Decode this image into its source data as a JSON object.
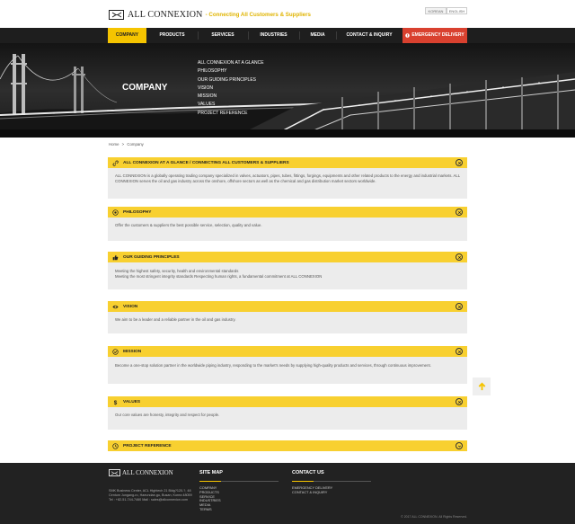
{
  "header": {
    "logo_text": "ALL CONNEXION",
    "tagline": "- Connecting All Customers & Suppliers",
    "lang_korean": "KOREAN",
    "lang_english": "ENGLISH"
  },
  "nav": {
    "items": [
      {
        "label": "COMPANY",
        "active": true
      },
      {
        "label": "PRODUCTS"
      },
      {
        "label": "SERVICES"
      },
      {
        "label": "INDUSTRIES"
      },
      {
        "label": "MEDIA"
      },
      {
        "label": "CONTACT & INQUIRY"
      },
      {
        "label": "EMERGENCY DELIVERY",
        "icon": "alert-circle-icon"
      }
    ],
    "active_color": "#f5c400",
    "emergency_color": "#d9412f"
  },
  "hero": {
    "title": "COMPANY",
    "submenu": [
      "ALL CONNEXION AT A GLANCE",
      "PHILOSOPHY",
      "OUR GUIDING PRINCIPLES",
      "VISION",
      "MISSION",
      "VALUES",
      "PROJECT REFERENCE"
    ]
  },
  "breadcrumb": {
    "home": "Home",
    "sep": ">",
    "current": "Company"
  },
  "sections": [
    {
      "title": "ALL CONNEXION AT A GLANCE / CONNECTING ALL CUSTOMERS & SUPPLIERS",
      "icon": "link-icon",
      "lines": [
        "ALL CONNEXION is a globally operating trading company specialized in valves, actuators, pipes, tubes, fittings, forgings, equipments and other related products to the energy and industrial markets. ALL CONNEXION serves the oil and gas industry across the onshore, offshore sectors as well as the chemical and gas distribution market sectors worldwide."
      ]
    },
    {
      "title": "PHILOSOPHY",
      "icon": "target-icon",
      "lines": [
        "Offer the customers & suppliers the best possible service, selection, quality and value."
      ]
    },
    {
      "title": "OUR GUIDING PRINCIPLES",
      "icon": "thumbs-up-icon",
      "lines": [
        "Meeting the highest safety, security, health and environmental standards",
        "Meeting the most stringent integrity standards Respecting human rights, a fundamental commitment at ALL CONNEXION"
      ]
    },
    {
      "title": "VISION",
      "icon": "eye-icon",
      "lines": [
        "We aim to be a leader and a reliable partner in the oil and gas industry."
      ]
    },
    {
      "title": "MISSION",
      "icon": "check-circle-icon",
      "lines": [
        "Become a one-stop solution partner in the worldwide piping industry, responding to the market's needs by supplying high-quality products and services, through continuous improvement."
      ]
    },
    {
      "title": "VALUES",
      "icon": "dollar-icon",
      "lines": [
        "Our core values are honesty, integrity and respect for people."
      ]
    },
    {
      "title": "PROJECT REFERENCE",
      "icon": "history-icon",
      "lines": []
    }
  ],
  "footer": {
    "logo_text": "ALL CONNEXION",
    "address": "SMK Business Center, ACL Hightech 21 Bldg?120-?, 48 Centum Jungang-ro, Haeundae-gu, Busan, Korea 48059 Tel : +82-51-744-7460 Mail : sales@allconnexion.com",
    "sitemap_title": "SITE MAP",
    "sitemap_items": [
      "COMPANY",
      "PRODUCTS",
      "SERVICE",
      "INDUSTRIES",
      "MEDIA",
      "TERMS"
    ],
    "contact_title": "CONTACT US",
    "contact_items": [
      "EMERGENCY DELIVERY",
      "CONTACT & INQUIRY"
    ],
    "copyright": "© 2017 ALL CONNEXION. All Rights Reserved."
  },
  "colors": {
    "accent": "#f8d030",
    "dark": "#1e1e1e",
    "section_bg": "#ececec"
  }
}
